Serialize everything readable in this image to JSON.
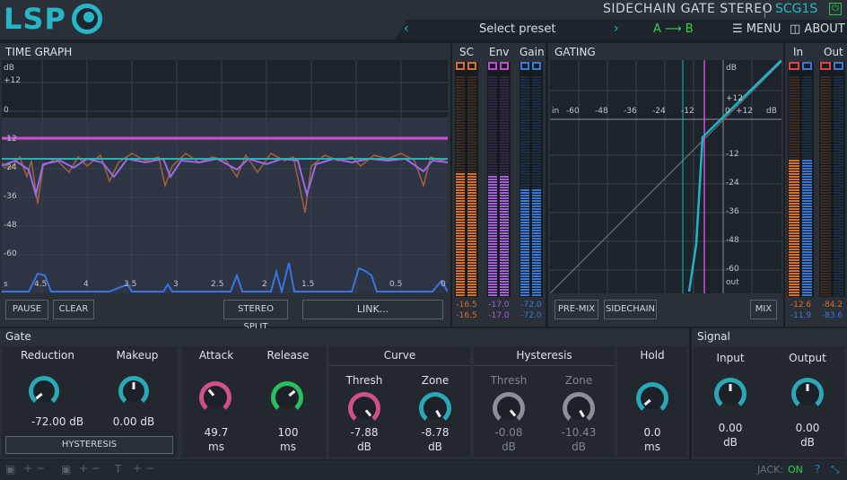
{
  "header": {
    "logo": "LSP",
    "plugin_name": "SIDECHAIN GATE STEREO",
    "plugin_id": "SCG1S",
    "power_icon": "power-icon",
    "preset_prev": "‹",
    "preset_label": "Select preset",
    "preset_next": "›",
    "ab_label": "A ⟶ B",
    "menu_label": "MENU",
    "about_label": "ABOUT"
  },
  "time_graph": {
    "title": "TIME GRAPH",
    "y_labels": [
      "dB",
      "+12",
      "0",
      "-12",
      "-24",
      "-36",
      "-48",
      "-60"
    ],
    "x_labels": [
      "s",
      "4.5",
      "4",
      "3.5",
      "3",
      "2.5",
      "2",
      "1.5",
      "0.5",
      "0"
    ],
    "buttons": {
      "pause": "PAUSE",
      "clear": "CLEAR",
      "stereo_split": "STEREO SPLIT",
      "link": "LINK..."
    }
  },
  "meters": {
    "sc": {
      "label": "SC",
      "top": "-16.5",
      "bottom": "-16.5",
      "level": 0.56,
      "color": "#d8702a"
    },
    "env": {
      "label": "Env",
      "top": "-17.0",
      "bottom": "-17.0",
      "level": 0.55,
      "color": "#a35fd8"
    },
    "gain": {
      "label": "Gain",
      "top": "-72.0",
      "bottom": "-72.0",
      "level": 0.49,
      "color": "#3a78d8"
    },
    "in": {
      "label": "In",
      "top": "-12.6",
      "bottom": "-11.9",
      "level": 0.62
    },
    "out": {
      "label": "Out",
      "top": "-84.2",
      "bottom": "-83.6",
      "level": 0.0
    }
  },
  "gating": {
    "title": "GATING",
    "x_labels": [
      "in",
      "-60",
      "-48",
      "-36",
      "-24",
      "-12",
      "0",
      "+12",
      "dB"
    ],
    "y_labels": [
      "dB",
      "+12",
      "0",
      "-12",
      "-24",
      "-36",
      "-48",
      "-60",
      "out"
    ],
    "buttons": {
      "pre_mix": "PRE-MIX",
      "sidechain": "SIDECHAIN",
      "mix": "MIX"
    }
  },
  "gate": {
    "title": "Gate",
    "reduction": {
      "label": "Reduction",
      "value": "-72.00 dB",
      "color": "#2aa8b8"
    },
    "makeup": {
      "label": "Makeup",
      "value": "0.00 dB",
      "color": "#2aa8b8"
    },
    "hysteresis_button": "HYSTERESIS",
    "attack": {
      "label": "Attack",
      "value": "49.7",
      "unit": "ms",
      "color": "#d0508a"
    },
    "release": {
      "label": "Release",
      "value": "100",
      "unit": "ms",
      "color": "#28c060"
    },
    "curve": {
      "title": "Curve",
      "thresh_label": "Thresh",
      "thresh_value": "-7.88",
      "thresh_unit": "dB",
      "zone_label": "Zone",
      "zone_value": "-8.78",
      "zone_unit": "dB"
    },
    "hysteresis": {
      "title": "Hysteresis",
      "thresh_label": "Thresh",
      "thresh_value": "-0.08",
      "thresh_unit": "dB",
      "zone_label": "Zone",
      "zone_value": "-10.43",
      "zone_unit": "dB"
    },
    "hold": {
      "title": "Hold",
      "value": "0.0",
      "unit": "ms"
    }
  },
  "signal": {
    "title": "Signal",
    "input": {
      "label": "Input",
      "value": "0.00",
      "unit": "dB"
    },
    "output": {
      "label": "Output",
      "value": "0.00",
      "unit": "dB"
    }
  },
  "footer": {
    "jack_label": "JACK:",
    "jack_status": "ON"
  }
}
